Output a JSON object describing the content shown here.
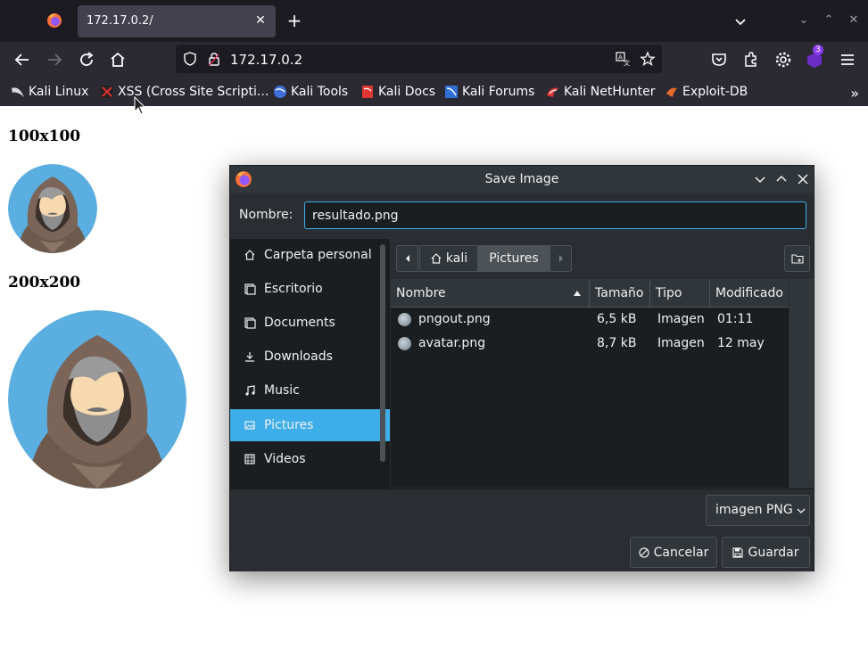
{
  "browser": {
    "tab_title": "172.17.0.2/",
    "url": "172.17.0.2",
    "extension_badge": "3",
    "bookmarks": [
      {
        "label": "Kali Linux"
      },
      {
        "label": "XSS (Cross Site Scripti..."
      },
      {
        "label": "Kali Tools"
      },
      {
        "label": "Kali Docs"
      },
      {
        "label": "Kali Forums"
      },
      {
        "label": "Kali NetHunter"
      },
      {
        "label": "Exploit-DB"
      }
    ]
  },
  "page": {
    "heading_small": "100x100",
    "heading_large": "200x200"
  },
  "dialog": {
    "title": "Save Image",
    "name_label": "Nombre:",
    "name_value": "resultado.png",
    "places": [
      {
        "label": "Carpeta personal",
        "icon": "home-icon"
      },
      {
        "label": "Escritorio",
        "icon": "desktop-icon"
      },
      {
        "label": "Documents",
        "icon": "documents-icon"
      },
      {
        "label": "Downloads",
        "icon": "download-icon"
      },
      {
        "label": "Music",
        "icon": "music-icon"
      },
      {
        "label": "Pictures",
        "icon": "pictures-icon"
      },
      {
        "label": "Videos",
        "icon": "videos-icon"
      }
    ],
    "active_place": "Pictures",
    "path": [
      "kali",
      "Pictures"
    ],
    "columns": [
      "Nombre",
      "Tamaño",
      "Tipo",
      "Modificado"
    ],
    "files": [
      {
        "name": "pngout.png",
        "size": "6,5 kB",
        "type": "Imagen",
        "modified": "01:11"
      },
      {
        "name": "avatar.png",
        "size": "8,7 kB",
        "type": "Imagen",
        "modified": "12 may"
      }
    ],
    "filter": "imagen PNG",
    "cancel_label": "Cancelar",
    "save_label": "Guardar"
  },
  "colors": {
    "accent": "#3daee9",
    "dialog_bg": "#2a2e32",
    "tabbar_bg": "#1c1b22",
    "toolbar_bg": "#2b2a33"
  }
}
